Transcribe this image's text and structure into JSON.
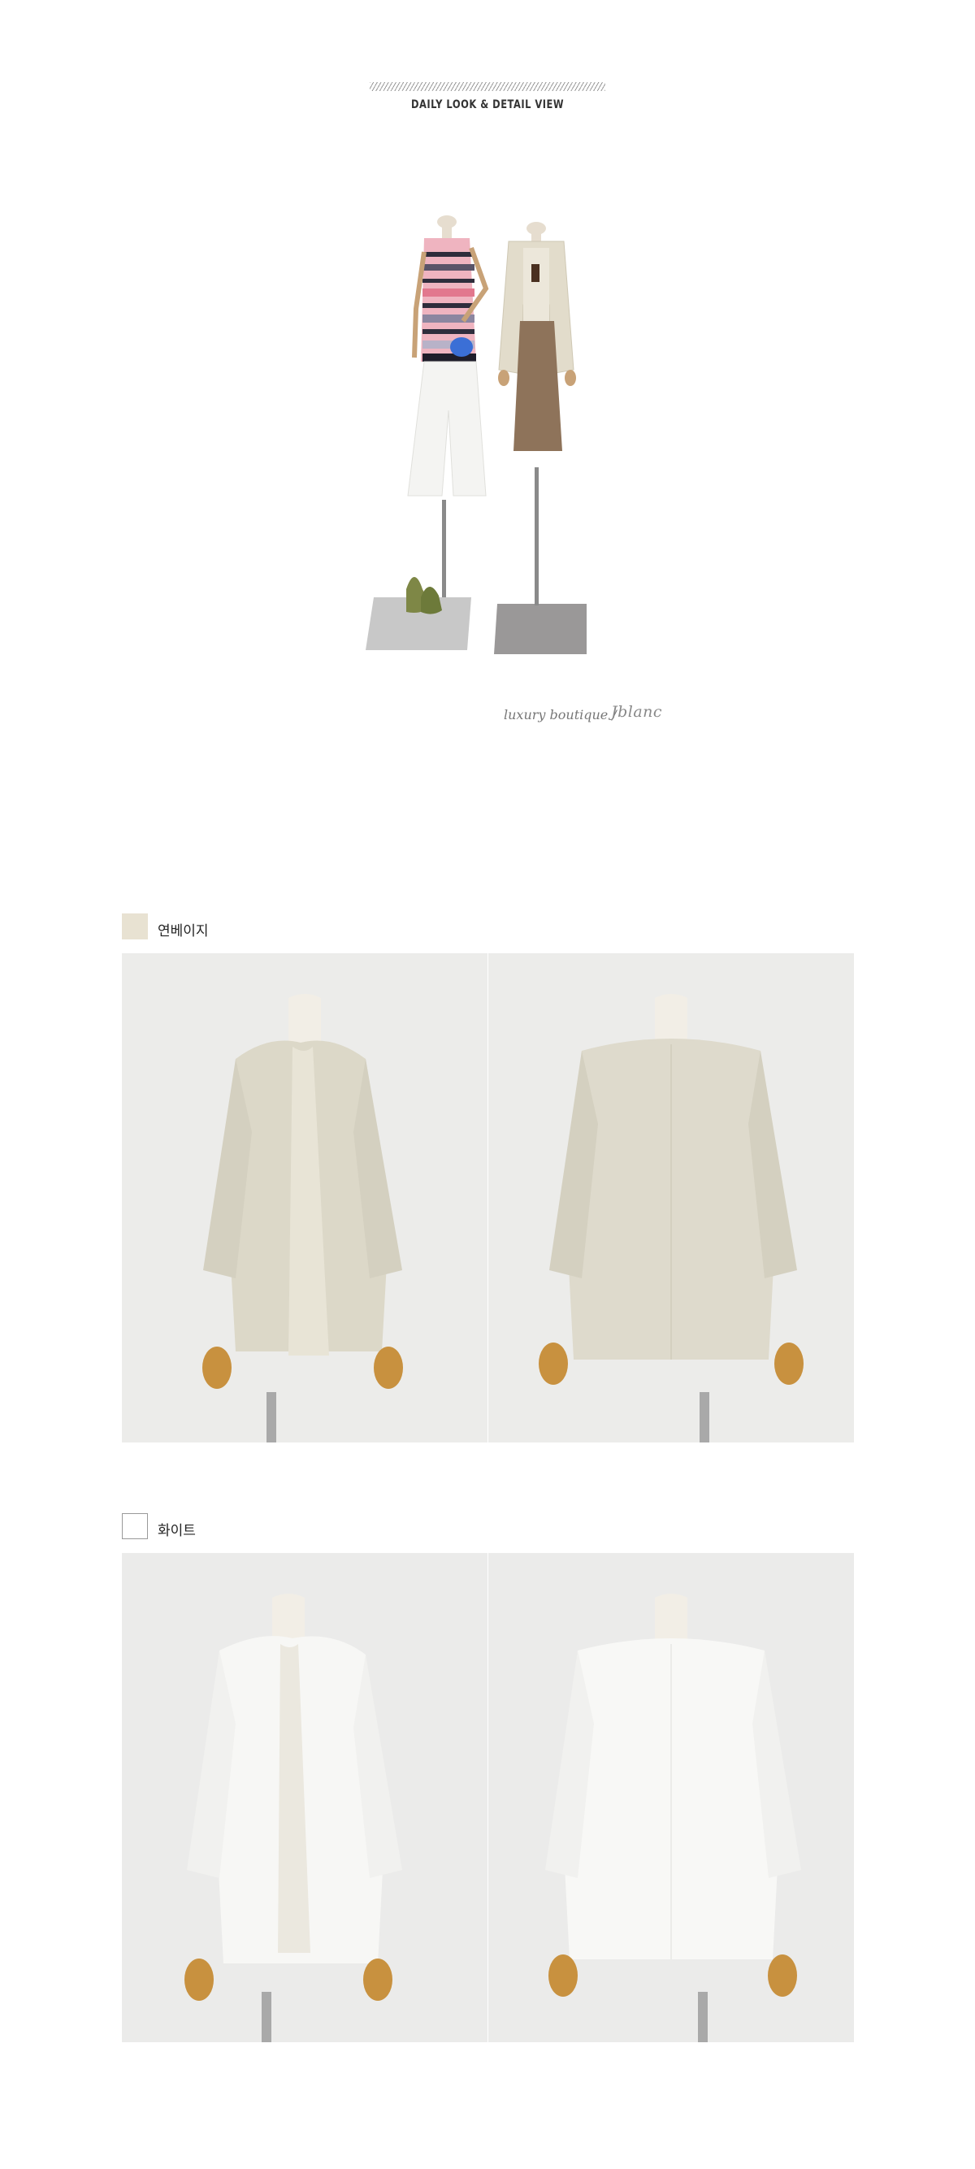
{
  "header": {
    "title": "DAILY LOOK & DETAIL VIEW"
  },
  "lookbook": {
    "tagline": "luxury boutique /",
    "signature_alt": "Jblanc"
  },
  "colors": [
    {
      "label": "연베이지",
      "swatch": "#e8e2d2"
    },
    {
      "label": "화이트",
      "swatch": "#ffffff"
    }
  ]
}
